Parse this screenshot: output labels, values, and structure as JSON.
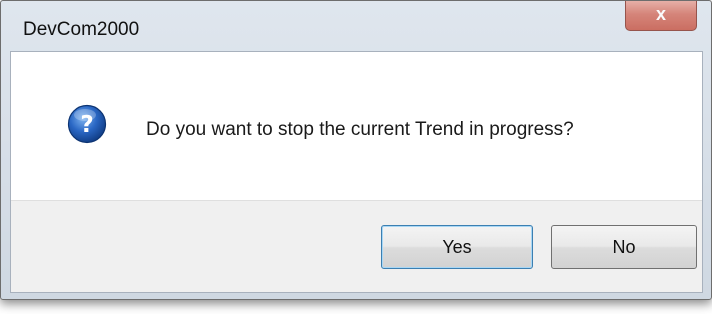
{
  "dialog": {
    "title": "DevCom2000",
    "close_label": "x",
    "icon": "question-icon",
    "message": "Do you want to stop the current Trend in progress?",
    "buttons": {
      "yes_label": "Yes",
      "no_label": "No"
    }
  },
  "colors": {
    "close_button": "#c85a4a",
    "icon_blue": "#1f5fb5",
    "button_bar": "#f0f0f0",
    "default_button_border": "#3c7fb1"
  }
}
